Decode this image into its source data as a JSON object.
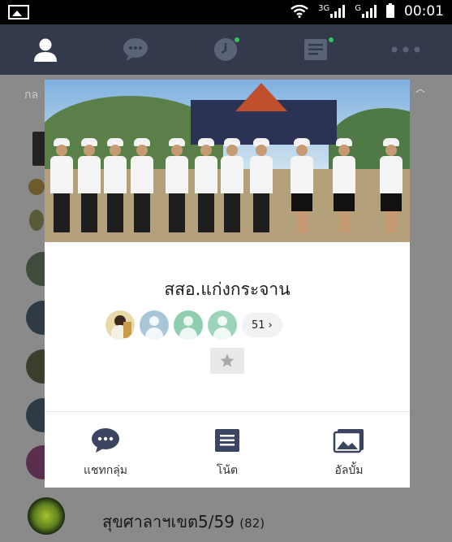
{
  "status_bar": {
    "network_3g": "3G",
    "network_g": "G",
    "time": "00:01",
    "icons": [
      "gallery-icon",
      "wifi-icon",
      "signal-icon",
      "signal-icon",
      "battery-icon"
    ]
  },
  "nav": {
    "tabs": [
      {
        "name": "friends",
        "icon": "person-icon",
        "active": true
      },
      {
        "name": "chats",
        "icon": "chat-bubble-icon"
      },
      {
        "name": "timeline",
        "icon": "clock-icon",
        "badge": true
      },
      {
        "name": "news",
        "icon": "news-icon",
        "badge": true
      },
      {
        "name": "more",
        "icon": "more-icon"
      }
    ]
  },
  "background_list": {
    "header_fragment": "กล",
    "last_item": {
      "name": "สุขศาลาฯเขต5/59",
      "count": "(82)"
    }
  },
  "group_popup": {
    "group_name": "สสอ.แก่งกระจาน",
    "member_count": "51",
    "member_avatars": [
      "#c99a4a",
      "#a8c6d8",
      "#8fcfb0",
      "#9bd4b8"
    ],
    "actions": [
      {
        "label": "แชทกลุ่ม",
        "icon": "chat-bubble-icon"
      },
      {
        "label": "โน้ต",
        "icon": "note-icon"
      },
      {
        "label": "อัลบั้ม",
        "icon": "album-icon"
      }
    ]
  },
  "colors": {
    "nav_bg": "#323a4c",
    "icon_dark": "#3b4460",
    "badge_green": "#2fc55b",
    "overlay": "#8a8a8a"
  }
}
